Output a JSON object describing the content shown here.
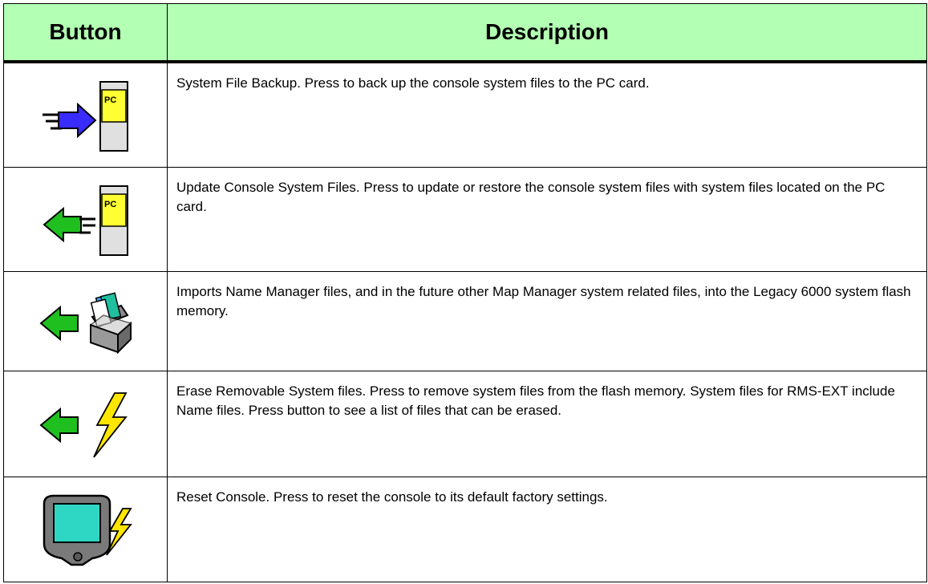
{
  "table": {
    "headers": {
      "button": "Button",
      "description": "Description"
    },
    "rows": [
      {
        "icon": "backup-to-pc-card-icon",
        "description": "System File Backup. Press to back up the console system files to the PC card."
      },
      {
        "icon": "update-from-pc-card-icon",
        "description": "Update Console System Files. Press to update or restore the console system files with system files located on the PC card."
      },
      {
        "icon": "import-files-icon",
        "description": "Imports Name Manager files, and in the future other Map Manager system related files, into the Legacy 6000 system flash memory."
      },
      {
        "icon": "erase-flash-icon",
        "description": "Erase Removable System files. Press to remove system files from the flash memory. System files for RMS-EXT include Name files. Press button to see a list of files that can be erased."
      },
      {
        "icon": "reset-console-icon",
        "description": "Reset Console. Press to reset the console to its default factory settings."
      }
    ],
    "pc_card_label": "PC",
    "colors": {
      "header_bg": "#b3ffb3",
      "blue_arrow": "#3a2bff",
      "green_arrow": "#1fbf1f",
      "card_yellow": "#ffff33",
      "screen_teal": "#2ed6c4",
      "bolt_yellow": "#ffe600"
    }
  }
}
